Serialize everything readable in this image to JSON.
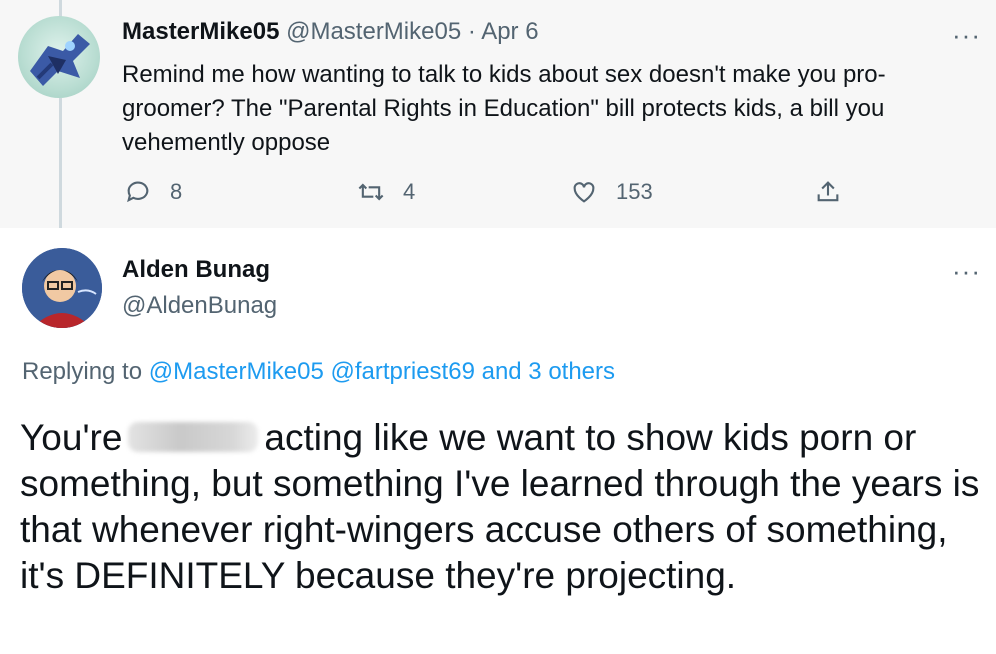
{
  "parent_tweet": {
    "display_name": "MasterMike05",
    "handle": "@MasterMike05",
    "separator": "·",
    "date": "Apr 6",
    "text": "Remind me how wanting to talk to kids about sex doesn't make you pro-groomer? The \"Parental Rights in Education\" bill protects kids, a bill you vehemently oppose",
    "replies": "8",
    "retweets": "4",
    "likes": "153",
    "more": "···"
  },
  "reply_tweet": {
    "display_name": "Alden Bunag",
    "handle": "@AldenBunag",
    "more": "···",
    "replying_prefix": "Replying to",
    "replying_users": "@MasterMike05 @fartpriest69",
    "replying_and": "and 3 others",
    "text_before_blur": "You're",
    "text_after_blur": "acting like we want to show kids porn or something, but something I've learned through the years is that whenever right-wingers accuse others of something, it's DEFINITELY because they're projecting."
  },
  "colors": {
    "link": "#1d9bf0",
    "muted": "#536471",
    "text": "#0f1419"
  },
  "icons": [
    "reply-icon",
    "retweet-icon",
    "like-icon",
    "share-icon",
    "more-icon"
  ]
}
